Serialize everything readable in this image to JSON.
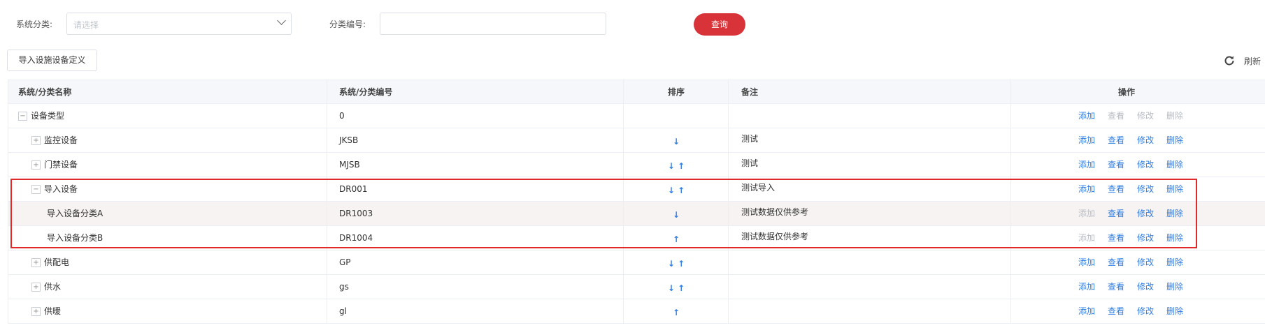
{
  "filters": {
    "category_label": "系统分类:",
    "category_placeholder": "请选择",
    "code_label": "分类编号:",
    "code_value": "",
    "query_label": "查询"
  },
  "toolbar": {
    "import_label": "导入设施设备定义",
    "refresh_label": "刷新"
  },
  "table": {
    "headers": {
      "name": "系统/分类名称",
      "code": "系统/分类编号",
      "sort": "排序",
      "remark": "备注",
      "ops": "操作"
    },
    "op_labels": {
      "add": "添加",
      "view": "查看",
      "edit": "修改",
      "delete": "删除"
    },
    "rows": [
      {
        "name": "设备类型",
        "code": "0",
        "sort": "",
        "remark": "",
        "toggle": "−",
        "ops_enabled": {
          "add": true,
          "view": false,
          "edit": false,
          "delete": false
        }
      },
      {
        "name": "监控设备",
        "code": "JKSB",
        "sort": "↓",
        "remark": "测试",
        "toggle": "+",
        "ops_enabled": {
          "add": true,
          "view": true,
          "edit": true,
          "delete": true
        }
      },
      {
        "name": "门禁设备",
        "code": "MJSB",
        "sort": "↓ ↑",
        "remark": "测试",
        "toggle": "+",
        "ops_enabled": {
          "add": true,
          "view": true,
          "edit": true,
          "delete": true
        }
      },
      {
        "name": "导入设备",
        "code": "DR001",
        "sort": "↓ ↑",
        "remark": "测试导入",
        "toggle": "−",
        "ops_enabled": {
          "add": true,
          "view": true,
          "edit": true,
          "delete": true
        }
      },
      {
        "name": "导入设备分类A",
        "code": "DR1003",
        "sort": "↓",
        "remark": "测试数据仅供参考",
        "toggle": "",
        "ops_enabled": {
          "add": false,
          "view": true,
          "edit": true,
          "delete": true
        }
      },
      {
        "name": "导入设备分类B",
        "code": "DR1004",
        "sort": "↑",
        "remark": "测试数据仅供参考",
        "toggle": "",
        "ops_enabled": {
          "add": false,
          "view": true,
          "edit": true,
          "delete": true
        }
      },
      {
        "name": "供配电",
        "code": "GP",
        "sort": "↓ ↑",
        "remark": "",
        "toggle": "+",
        "ops_enabled": {
          "add": true,
          "view": true,
          "edit": true,
          "delete": true
        }
      },
      {
        "name": "供水",
        "code": "gs",
        "sort": "↓ ↑",
        "remark": "",
        "toggle": "+",
        "ops_enabled": {
          "add": true,
          "view": true,
          "edit": true,
          "delete": true
        }
      },
      {
        "name": "供暖",
        "code": "gl",
        "sort": "↑",
        "remark": "",
        "toggle": "+",
        "ops_enabled": {
          "add": true,
          "view": true,
          "edit": true,
          "delete": true
        }
      }
    ]
  },
  "colors": {
    "primary": "#d9333a",
    "link": "#2f7de1",
    "disabled": "#b8bcc4",
    "highlight": "#e02a2a",
    "alt_row": "#f7f3f3"
  },
  "icons": {
    "refresh": "refresh-icon",
    "select_arrow": "chevron-down-icon",
    "expand": "plus-square-icon",
    "collapse": "minus-square-icon"
  }
}
